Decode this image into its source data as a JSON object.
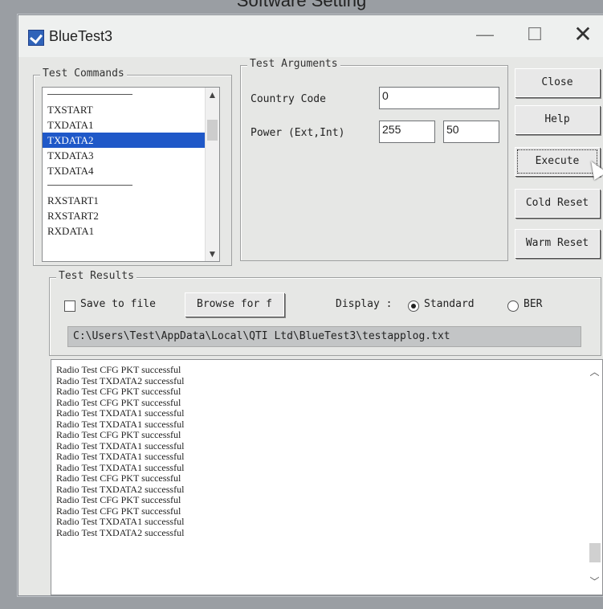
{
  "photo_caption": "Software Setting",
  "window": {
    "title": "BlueTest3",
    "minimize": "—",
    "maximize": "☐",
    "close": "✕"
  },
  "test_commands": {
    "legend": "Test Commands",
    "items": [
      {
        "label": "",
        "separator": true
      },
      {
        "label": "TXSTART"
      },
      {
        "label": "TXDATA1"
      },
      {
        "label": "TXDATA2",
        "selected": true
      },
      {
        "label": "TXDATA3"
      },
      {
        "label": "TXDATA4"
      },
      {
        "label": "",
        "separator": true
      },
      {
        "label": "RXSTART1"
      },
      {
        "label": "RXSTART2"
      },
      {
        "label": "RXDATA1"
      }
    ]
  },
  "test_arguments": {
    "legend": "Test Arguments",
    "country_code_label": "Country Code",
    "country_code_value": "0",
    "power_label": "Power (Ext,Int)",
    "power_ext_value": "255",
    "power_int_value": "50"
  },
  "buttons": {
    "close": "Close",
    "help": "Help",
    "execute": "Execute",
    "cold_reset": "Cold Reset",
    "warm_reset": "Warm Reset"
  },
  "test_results": {
    "legend": "Test Results",
    "save_to_file_label": "Save to file",
    "save_to_file_checked": false,
    "browse_label": "Browse for f",
    "display_label": "Display :",
    "standard_label": "Standard",
    "ber_label": "BER",
    "display_selected": "Standard",
    "path": "C:\\Users\\Test\\AppData\\Local\\QTI Ltd\\BlueTest3\\testapplog.txt"
  },
  "log": [
    "Radio Test CFG PKT successful",
    "Radio Test TXDATA2 successful",
    "Radio Test CFG PKT successful",
    "Radio Test CFG PKT successful",
    "Radio Test TXDATA1 successful",
    "Radio Test TXDATA1 successful",
    "Radio Test CFG PKT successful",
    "Radio Test TXDATA1 successful",
    "Radio Test TXDATA1 successful",
    "Radio Test TXDATA1 successful",
    "Radio Test CFG PKT successful",
    "Radio Test TXDATA2 successful",
    "Radio Test CFG PKT successful",
    "Radio Test CFG PKT successful",
    "Radio Test TXDATA1 successful",
    "Radio Test TXDATA2 successful"
  ],
  "icons": {
    "app": "bluetest-app-icon",
    "cursor": "mouse-pointer-icon"
  }
}
